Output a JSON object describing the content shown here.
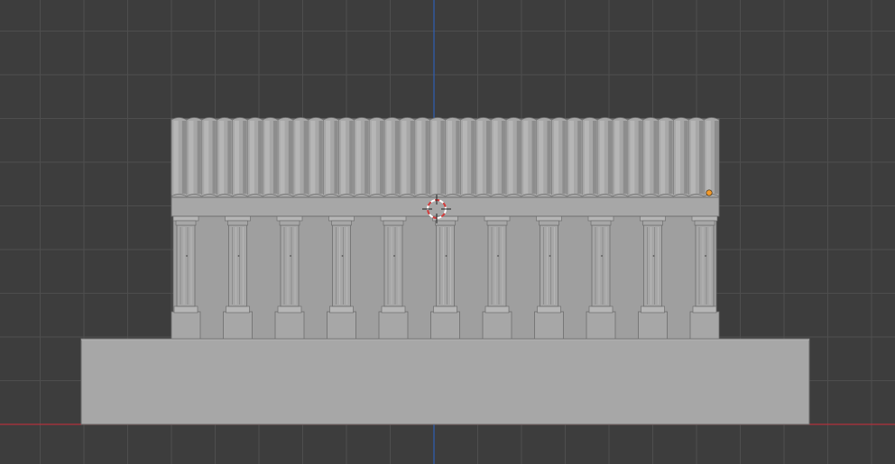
{
  "viewport": {
    "view": "front-orthographic",
    "grid_visible": true,
    "colors": {
      "background": "#3d3d3d",
      "grid_minor": "#464646",
      "grid_major": "#4e4e4e",
      "axis_x": "#b3313d",
      "axis_z": "#2f5fb3",
      "mesh_fill": "#a7a7a7",
      "mesh_light": "#b6b6b6",
      "mesh_shadow": "#8d8d8d",
      "mesh_edge": "#6e6e6e",
      "origin_point": "#f39a2b",
      "cursor_red": "#d33b3b",
      "cursor_white": "#ffffff"
    }
  },
  "scene": {
    "object": "temple",
    "column_count": 11,
    "roof_flute_count": 36,
    "has_base_platform": true,
    "has_3d_cursor": true,
    "has_object_origin": true
  }
}
